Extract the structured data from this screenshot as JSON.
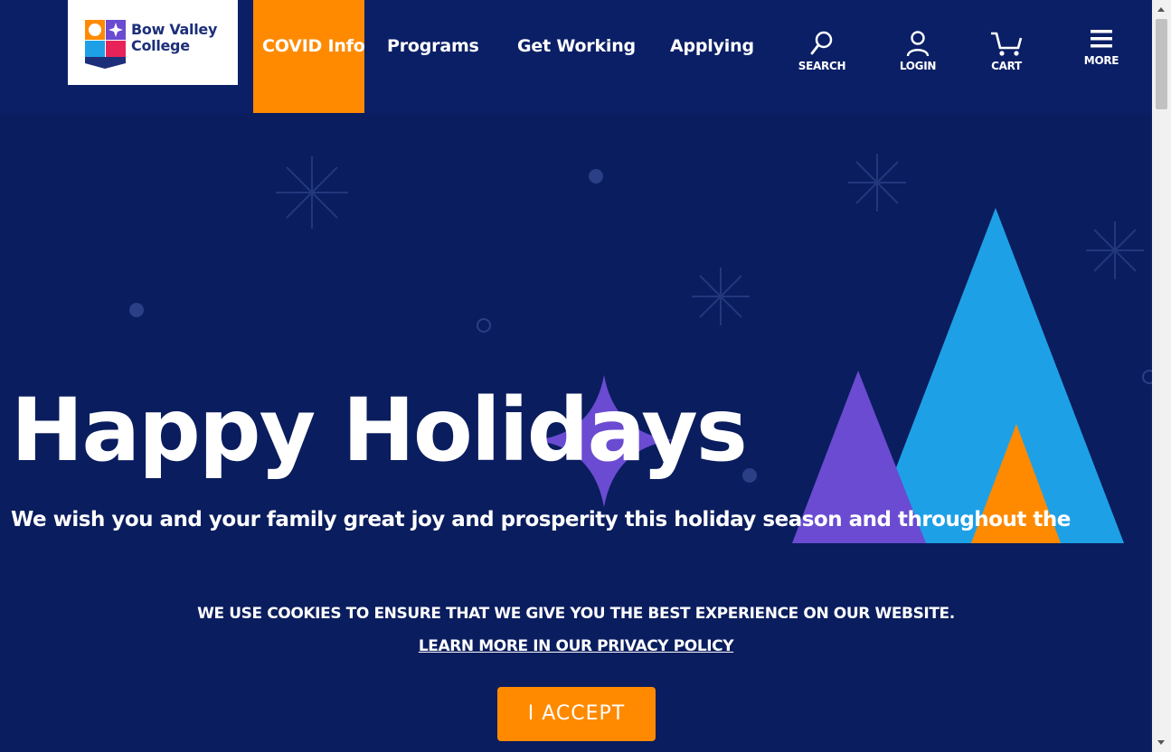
{
  "logo": {
    "line1": "Bow Valley",
    "line2": "College"
  },
  "nav": {
    "covid": "COVID Info",
    "programs": "Programs",
    "get_working": "Get Working",
    "applying": "Applying"
  },
  "utility": {
    "search": "SEARCH",
    "login": "LOGIN",
    "cart": "CART",
    "more": "MORE"
  },
  "hero": {
    "title": "Happy Holidays",
    "subtitle": "We wish you and your family great joy and prosperity this holiday season and throughout the"
  },
  "cookie": {
    "message": "WE USE COOKIES TO ENSURE THAT WE GIVE YOU THE BEST EXPERIENCE ON OUR WEBSITE.",
    "link": "LEARN MORE IN OUR PRIVACY POLICY",
    "accept": "I ACCEPT"
  },
  "colors": {
    "header_bg": "#0b1f66",
    "hero_bg": "#0a1d5e",
    "accent_orange": "#ff8a00",
    "tree_blue": "#1ea0e6",
    "tree_purple": "#6a4bd1"
  },
  "icons": [
    "search-icon",
    "user-icon",
    "cart-icon",
    "hamburger-icon",
    "snowflake-icon",
    "star-icon"
  ]
}
